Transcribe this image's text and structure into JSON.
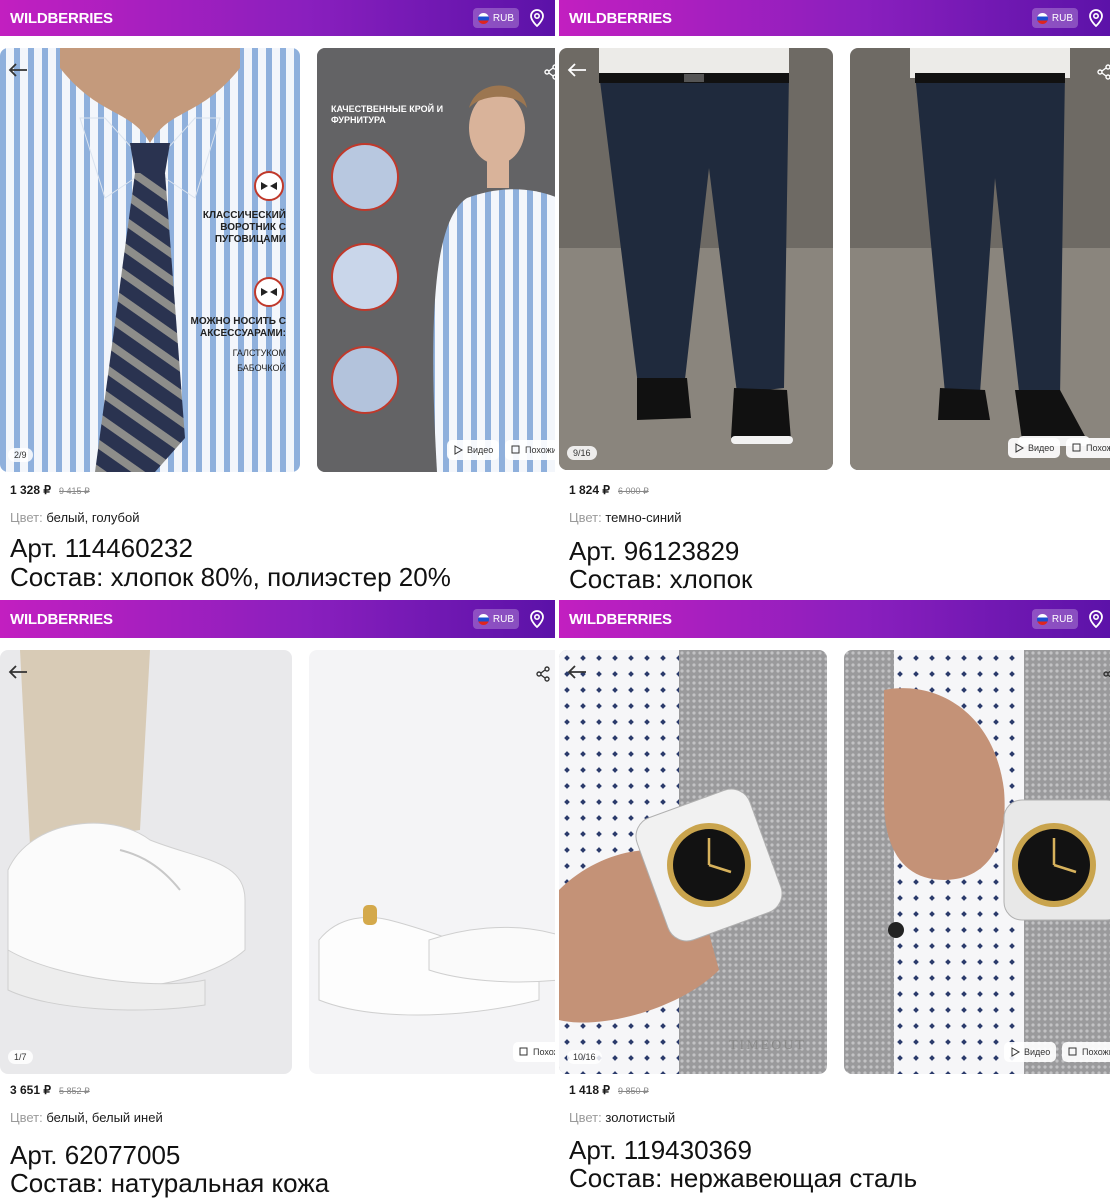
{
  "brand": "WILDBERRIES",
  "currency": "RUB",
  "labels": {
    "color": "Цвет:",
    "video": "Видео",
    "similar": "Похожие"
  },
  "products": [
    {
      "counter": "2/9",
      "price": "1 328 ₽",
      "old_price": "9 415 ₽",
      "color": "белый, голубой",
      "article": "Арт. 114460232",
      "composition": "Состав: хлопок 80%, полиэстер 20%",
      "annotations": {
        "collar": "КЛАССИЧЕСКИЙ ВОРОТНИК С ПУГОВИЦАМИ",
        "accessories": "МОЖНО НОСИТЬ С АКСЕССУАРАМИ:",
        "tie": "ГАЛСТУКОМ",
        "bow": "БАБОЧКОЙ",
        "quality": "КАЧЕСТВЕННЫЕ КРОЙ И ФУРНИТУРА"
      }
    },
    {
      "counter": "9/16",
      "price": "1 824 ₽",
      "old_price": "6 000 ₽",
      "color": "темно-синий",
      "article": "Арт. 96123829",
      "composition": "Состав: хлопок"
    },
    {
      "counter": "1/7",
      "price": "3 651 ₽",
      "old_price": "5 852 ₽",
      "color": "белый, белый иней",
      "article": "Арт. 62077005",
      "composition": "Состав: натуральная кожа"
    },
    {
      "counter": "10/16",
      "price": "1 418 ₽",
      "old_price": "9 850 ₽",
      "color": "золотистый",
      "article": "Арт. 119430369",
      "composition": "Состав: нержавеющая сталь",
      "watermark": "TIMEOUT"
    }
  ]
}
